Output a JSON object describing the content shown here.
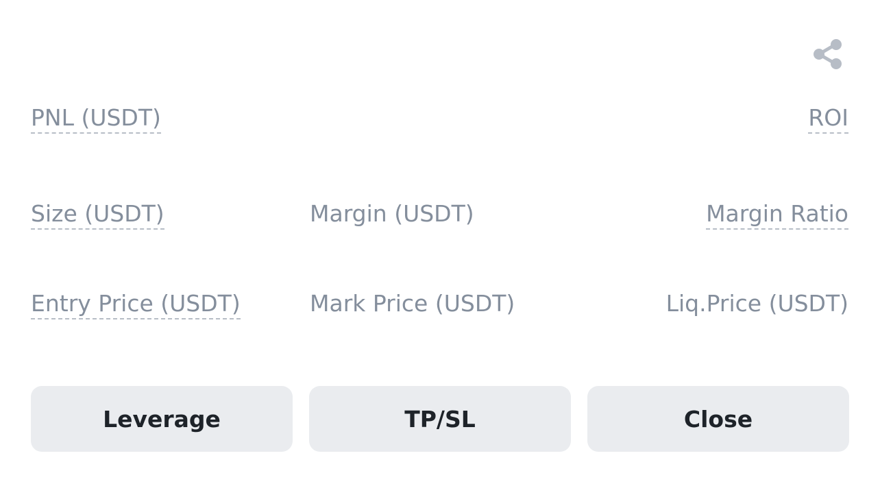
{
  "header": {
    "share_icon": "share-icon"
  },
  "row1": {
    "pnl_label": "PNL (USDT)",
    "roi_label": "ROI"
  },
  "row2": {
    "size_label": "Size (USDT)",
    "margin_label": "Margin (USDT)",
    "margin_ratio_label": "Margin Ratio"
  },
  "row3": {
    "entry_price_label": "Entry Price (USDT)",
    "mark_price_label": "Mark Price (USDT)",
    "liq_price_label": "Liq.Price (USDT)"
  },
  "actions": {
    "leverage_label": "Leverage",
    "tpsl_label": "TP/SL",
    "close_label": "Close"
  },
  "colors": {
    "label_text": "#848e9c",
    "button_bg": "#eaecef",
    "button_text": "#1e2329",
    "icon": "#b7bdc6"
  }
}
